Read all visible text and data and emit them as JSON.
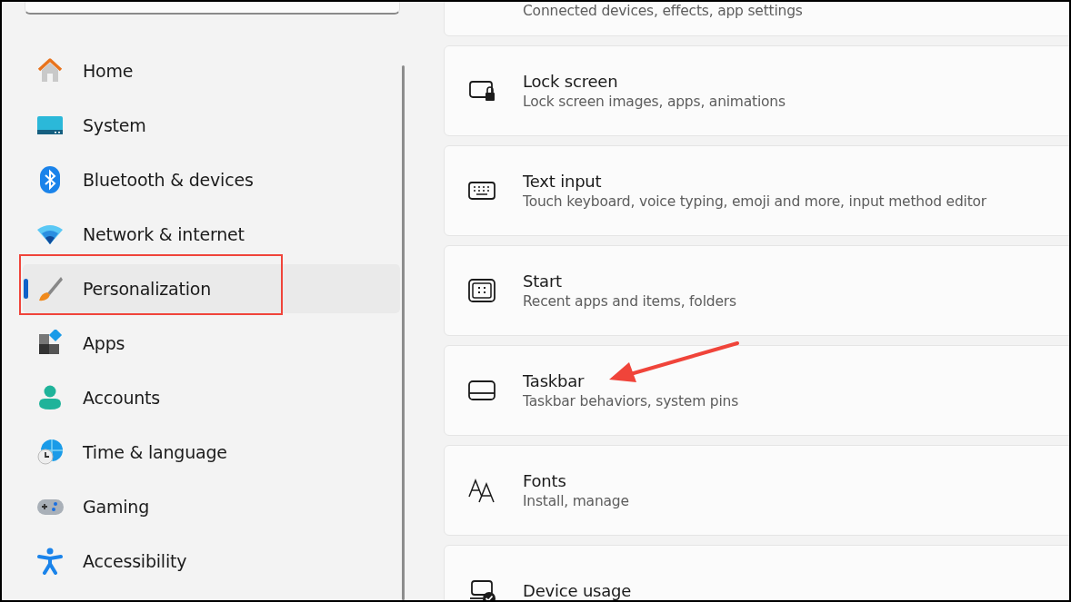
{
  "sidebar": {
    "search": true,
    "items": [
      {
        "label": "Home",
        "selected": false
      },
      {
        "label": "System",
        "selected": false
      },
      {
        "label": "Bluetooth & devices",
        "selected": false
      },
      {
        "label": "Network & internet",
        "selected": false
      },
      {
        "label": "Personalization",
        "selected": true
      },
      {
        "label": "Apps",
        "selected": false
      },
      {
        "label": "Accounts",
        "selected": false
      },
      {
        "label": "Time & language",
        "selected": false
      },
      {
        "label": "Gaming",
        "selected": false
      },
      {
        "label": "Accessibility",
        "selected": false
      }
    ]
  },
  "settings": [
    {
      "subtitle": "Connected devices, effects, app settings"
    },
    {
      "title": "Lock screen",
      "subtitle": "Lock screen images, apps, animations"
    },
    {
      "title": "Text input",
      "subtitle": "Touch keyboard, voice typing, emoji and more, input method editor"
    },
    {
      "title": "Start",
      "subtitle": "Recent apps and items, folders"
    },
    {
      "title": "Taskbar",
      "subtitle": "Taskbar behaviors, system pins"
    },
    {
      "title": "Fonts",
      "subtitle": "Install, manage"
    },
    {
      "title": "Device usage"
    }
  ]
}
